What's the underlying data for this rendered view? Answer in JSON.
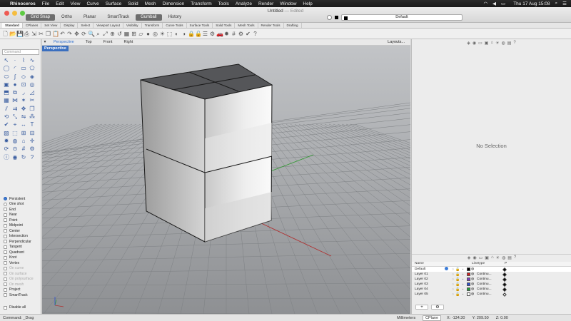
{
  "menubar": {
    "app": "Rhinoceros",
    "items": [
      "File",
      "Edit",
      "View",
      "Curve",
      "Surface",
      "Solid",
      "Mesh",
      "Dimension",
      "Transform",
      "Tools",
      "Analyze",
      "Render",
      "Window",
      "Help"
    ],
    "clock": "Thu 17 Aug 15:08"
  },
  "titlebar": {
    "title": "Untitled",
    "edited": "— Edited",
    "toggles": [
      {
        "label": "Grid Snap",
        "on": true
      },
      {
        "label": "Ortho",
        "on": false
      },
      {
        "label": "Planar",
        "on": false
      },
      {
        "label": "SmartTrack",
        "on": false
      },
      {
        "label": "Gumball",
        "on": true
      },
      {
        "label": "History",
        "on": false
      }
    ],
    "current_layer": "Default"
  },
  "tabs": [
    "Standard",
    "CPlanes",
    "Set View",
    "Display",
    "Select",
    "Viewport Layout",
    "Visibility",
    "Transform",
    "Curve Tools",
    "Surface Tools",
    "Solid Tools",
    "Mesh Tools",
    "Render Tools",
    "Drafting"
  ],
  "active_tab": "Standard",
  "command_placeholder": "Command",
  "osnaps": [
    {
      "label": "Persistent",
      "kind": "radio",
      "on": true
    },
    {
      "label": "One shot",
      "kind": "radio",
      "on": false
    },
    {
      "label": "End",
      "kind": "check",
      "dim": false
    },
    {
      "label": "Near",
      "kind": "check",
      "dim": false
    },
    {
      "label": "Point",
      "kind": "check",
      "dim": false
    },
    {
      "label": "Midpoint",
      "kind": "check",
      "dim": false
    },
    {
      "label": "Center",
      "kind": "check",
      "dim": false
    },
    {
      "label": "Intersection",
      "kind": "check",
      "dim": false
    },
    {
      "label": "Perpendicular",
      "kind": "check",
      "dim": false
    },
    {
      "label": "Tangent",
      "kind": "check",
      "dim": false
    },
    {
      "label": "Quadrant",
      "kind": "check",
      "dim": false
    },
    {
      "label": "Knot",
      "kind": "check",
      "dim": false
    },
    {
      "label": "Vertex",
      "kind": "check",
      "dim": false
    },
    {
      "label": "On curve",
      "kind": "check",
      "dim": true
    },
    {
      "label": "On surface",
      "kind": "check",
      "dim": true
    },
    {
      "label": "On polysurface",
      "kind": "check",
      "dim": true
    },
    {
      "label": "On mesh",
      "kind": "check",
      "dim": true
    },
    {
      "label": "Project",
      "kind": "check",
      "dim": false
    },
    {
      "label": "SmartTrack",
      "kind": "check",
      "dim": false
    }
  ],
  "disable_all": "Disable all",
  "viewport_tabs": [
    "Perspective",
    "Top",
    "Front",
    "Right"
  ],
  "active_viewport": "Perspective",
  "layouts_label": "Layouts...",
  "viewport_label": "Perspective",
  "properties": {
    "empty_text": "No Selection"
  },
  "layers": {
    "headers": {
      "name": "Name",
      "linetype": "Linetype",
      "p": "P"
    },
    "rows": [
      {
        "name": "Default",
        "color": "#000000",
        "linetype": "",
        "print_color": "#000000",
        "current": true
      },
      {
        "name": "Layer 01",
        "color": "#d21e1e",
        "linetype": "Continu...",
        "print_color": "#000000",
        "current": false
      },
      {
        "name": "Layer 02",
        "color": "#7a3fc0",
        "linetype": "Continu...",
        "print_color": "#000000",
        "current": false
      },
      {
        "name": "Layer 03",
        "color": "#2c4fd0",
        "linetype": "Continu...",
        "print_color": "#000000",
        "current": false
      },
      {
        "name": "Layer 04",
        "color": "#1f9e3a",
        "linetype": "Continu...",
        "print_color": "#000000",
        "current": false
      },
      {
        "name": "Layer 05",
        "color": "#ffffff",
        "linetype": "Continu...",
        "print_color": "#ffffff",
        "current": false
      }
    ],
    "add_label": "+",
    "gear_label": "⚙"
  },
  "status": {
    "command": "Command: _Drag",
    "units": "Millimeters",
    "cplane": "CPlane",
    "x": "X: -134.30",
    "y": "Y: 209.50",
    "z": "Z: 0.00"
  },
  "colors": {
    "accent": "#3b7cd8",
    "grid_red": "#b03030",
    "grid_green": "#2f9a2f",
    "viewport_bg": "#9c9ea1"
  }
}
